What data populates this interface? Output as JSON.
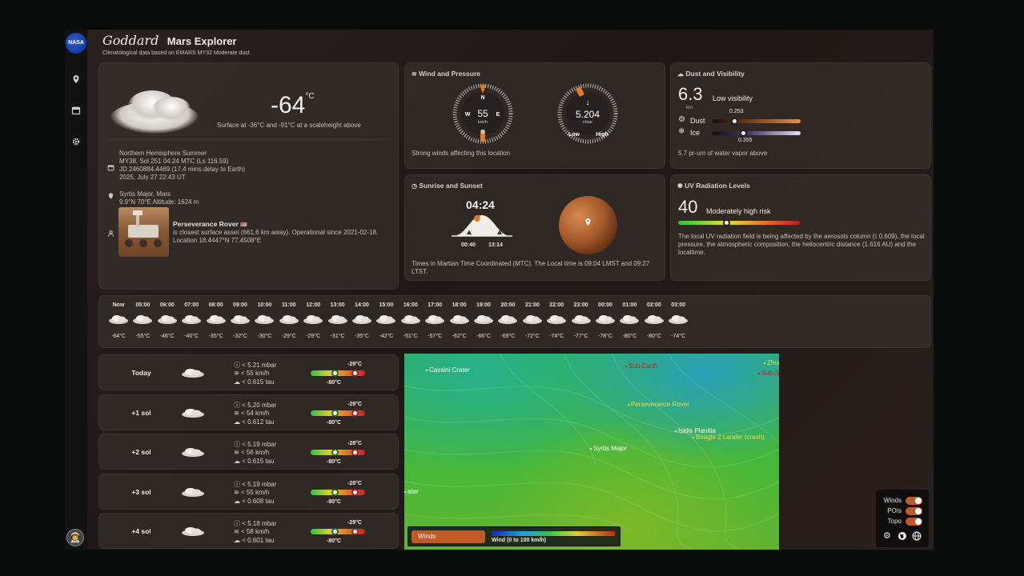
{
  "header": {
    "logo_text": "Goddard",
    "app_title": "Mars Explorer",
    "subtitle": "Climatological data based on EMARS MY32 Moderate dust"
  },
  "rail": {
    "logo": "NASA",
    "icons": [
      "location-pin-icon",
      "calendar-icon",
      "gear-icon"
    ],
    "avatar": "astronaut-avatar"
  },
  "current": {
    "temperature": "-64",
    "unit": "°C",
    "surface_note": "Surface at -36°C and -91°C at a scaleheight above",
    "season": "Northern Hemisphere Summer",
    "mars_date": "MY38, Sol 251 04:24 MTC (Ls 116.59)",
    "jd": "JD 2460884.4469 (17.4 mins delay to Earth)",
    "earth_date": "2025, July 27 22:43 UT",
    "location_name": "Syrtis Major, Mars",
    "location_coords": "9.9°N 70°E Altitude: 1624 m",
    "rover_name": "Perseverance Rover",
    "rover_flag": "🇺🇸",
    "rover_line1": "is closest surface asset (661.6 km away). Operational since 2021-02-18.",
    "rover_line2": "Location 18.4447°N 77.4508°E"
  },
  "wind": {
    "title": "Wind and Pressure",
    "speed": "55",
    "speed_unit": "km/h",
    "compass_n": "N",
    "compass_s": "S",
    "compass_e": "E",
    "compass_w": "W",
    "pressure": "5.204",
    "pressure_unit": "mbar",
    "low": "Low",
    "high": "High",
    "pressure_level": 0.15,
    "note": "Strong winds affecting this location"
  },
  "dust": {
    "title": "Dust and Visibility",
    "visibility": "6.3",
    "visibility_unit": "km",
    "visibility_label": "Low visibility",
    "dust_label": "Dust",
    "dust_value": "0.253",
    "dust_level": 0.25,
    "ice_label": "Ice",
    "ice_value": "0.355",
    "ice_level": 0.355,
    "note": "5.7 pr-um of water vapor above"
  },
  "sun": {
    "title": "Sunrise and Sunset",
    "time": "04:24",
    "sunrise": "00:40",
    "sunset": "13:14",
    "note": "Times in Martian Time Coordinated (MTC). The Local time is 09:04 LMST and 09:27 LTST."
  },
  "uv": {
    "title": "UV Radiation Levels",
    "value": "40",
    "label": "Moderately high risk",
    "level": 0.4,
    "note": "The local UV radiation field is being affected by the aerosols column (τ 0.609), the local pressure, the atmospheric composition, the heliocentric distance (1.616 AU) and the localtime."
  },
  "hourly": {
    "hours": [
      "Now",
      "05:00",
      "06:00",
      "07:00",
      "08:00",
      "09:00",
      "10:00",
      "11:00",
      "12:00",
      "13:00",
      "14:00",
      "15:00",
      "16:00",
      "17:00",
      "18:00",
      "19:00",
      "20:00",
      "21:00",
      "22:00",
      "23:00",
      "00:00",
      "01:00",
      "02:00",
      "03:00"
    ],
    "temps": [
      "-64°C",
      "-55°C",
      "-46°C",
      "-40°C",
      "-35°C",
      "-32°C",
      "-30°C",
      "-29°C",
      "-29°C",
      "-31°C",
      "-35°C",
      "-42°C",
      "-51°C",
      "-57°C",
      "-62°C",
      "-66°C",
      "-69°C",
      "-72°C",
      "-74°C",
      "-77°C",
      "-78°C",
      "-80°C",
      "-80°C",
      "-74°C"
    ]
  },
  "daily": [
    {
      "label": "Today",
      "pressure": "< 5.21 mbar",
      "wind": "< 55 km/h",
      "dust": "< 0.615 tau",
      "max": "-29°C",
      "min": "-80°C"
    },
    {
      "label": "+1 sol",
      "pressure": "< 5.20 mbar",
      "wind": "< 54 km/h",
      "dust": "< 0.612 tau",
      "max": "-29°C",
      "min": "-80°C"
    },
    {
      "label": "+2 sol",
      "pressure": "< 5.19 mbar",
      "wind": "< 56 km/h",
      "dust": "< 0.615 tau",
      "max": "-28°C",
      "min": "-80°C"
    },
    {
      "label": "+3 sol",
      "pressure": "< 5.19 mbar",
      "wind": "< 55 km/h",
      "dust": "< 0.608 tau",
      "max": "-28°C",
      "min": "-80°C"
    },
    {
      "label": "+4 sol",
      "pressure": "< 5.18 mbar",
      "wind": "< 58 km/h",
      "dust": "< 0.601 tau",
      "max": "-29°C",
      "min": "-80°C"
    }
  ],
  "map": {
    "pois": [
      {
        "name": "Cassini Crater",
        "color": "#ffffff"
      },
      {
        "name": "Sub-Earth",
        "color": "#c82020"
      },
      {
        "name": "Zhur",
        "color": "#e8e040"
      },
      {
        "name": "Sub-S",
        "color": "#c82020"
      },
      {
        "name": "Perseverance Rover",
        "color": "#e8e040"
      },
      {
        "name": "Isidis Planitia",
        "color": "#ffffff"
      },
      {
        "name": "Beagle 2 Lander (crash)",
        "color": "#e8e040"
      },
      {
        "name": "Syrtis Major",
        "color": "#ffffff"
      },
      {
        "name": "ater",
        "color": "#ffffff"
      }
    ],
    "layer_button": "Winds",
    "legend_label": "Wind (0 to 100 km/h)"
  },
  "toggles": [
    {
      "label": "Winds",
      "on": true
    },
    {
      "label": "POIs",
      "on": true
    },
    {
      "label": "Topo",
      "on": true
    }
  ],
  "toggle_icons": [
    "settings-icon",
    "globe-icon",
    "grid-globe-icon"
  ]
}
